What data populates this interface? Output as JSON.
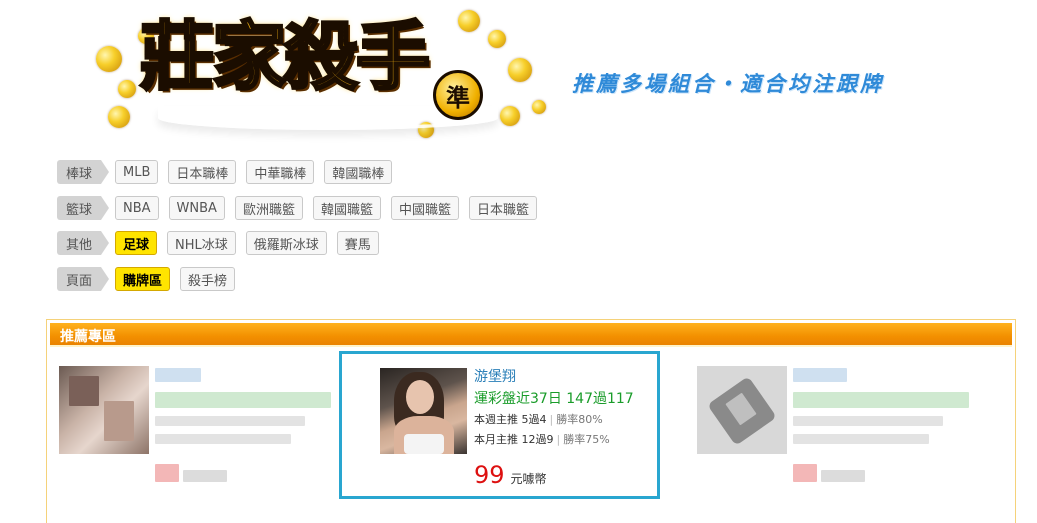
{
  "header": {
    "logo_text": "莊家殺手",
    "logo_badge": "準",
    "tagline": "推薦多場組合・適合均注跟牌"
  },
  "categories": [
    {
      "label": "棒球",
      "items": [
        {
          "text": "MLB",
          "active": false
        },
        {
          "text": "日本職棒",
          "active": false
        },
        {
          "text": "中華職棒",
          "active": false
        },
        {
          "text": "韓國職棒",
          "active": false
        }
      ]
    },
    {
      "label": "籃球",
      "items": [
        {
          "text": "NBA",
          "active": false
        },
        {
          "text": "WNBA",
          "active": false
        },
        {
          "text": "歐洲職籃",
          "active": false
        },
        {
          "text": "韓國職籃",
          "active": false
        },
        {
          "text": "中國職籃",
          "active": false
        },
        {
          "text": "日本職籃",
          "active": false
        }
      ]
    },
    {
      "label": "其他",
      "items": [
        {
          "text": "足球",
          "active": true
        },
        {
          "text": "NHL冰球",
          "active": false
        },
        {
          "text": "俄羅斯冰球",
          "active": false
        },
        {
          "text": "賽馬",
          "active": false
        }
      ]
    },
    {
      "label": "頁面",
      "items": [
        {
          "text": "購牌區",
          "active": true
        },
        {
          "text": "殺手榜",
          "active": false
        }
      ]
    }
  ],
  "recommend": {
    "title": "推薦專區",
    "featured": {
      "name": "游堡翔",
      "record": "運彩盤近37日 147過117",
      "week_label": "本週主推 5過4",
      "week_rate": "勝率80%",
      "month_label": "本月主推 12過9",
      "month_rate": "勝率75%",
      "price": "99",
      "price_unit": "元噱幣"
    }
  },
  "colors": {
    "accent_orange": "#f39000",
    "active_yellow": "#ffe400",
    "featured_border": "#29a6d0",
    "name_blue": "#2a7fb8",
    "record_green": "#1a9c2a",
    "price_red": "#dd1010",
    "tagline_blue": "#2f8ad8"
  }
}
